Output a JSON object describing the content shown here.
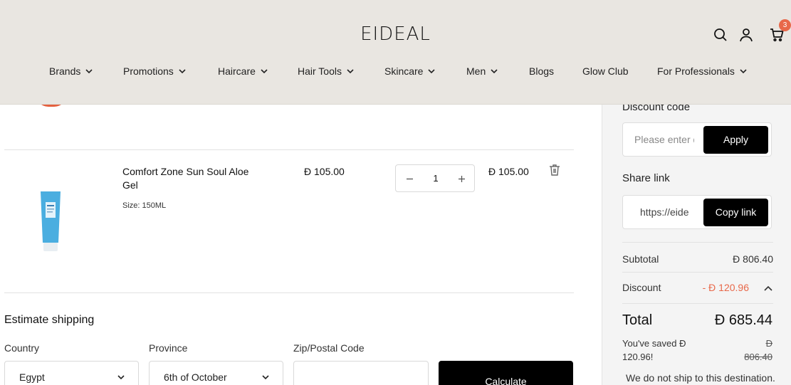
{
  "header": {
    "logo": "EIDEAL",
    "cart_count": "3",
    "icons": {
      "search": "search-icon",
      "account": "user-icon",
      "cart": "cart-icon"
    },
    "nav": [
      {
        "label": "Brands",
        "dropdown": true
      },
      {
        "label": "Promotions",
        "dropdown": true
      },
      {
        "label": "Haircare",
        "dropdown": true
      },
      {
        "label": "Hair Tools",
        "dropdown": true
      },
      {
        "label": "Skincare",
        "dropdown": true
      },
      {
        "label": "Men",
        "dropdown": true
      },
      {
        "label": "Blogs",
        "dropdown": false
      },
      {
        "label": "Glow Club",
        "dropdown": false
      },
      {
        "label": "For Professionals",
        "dropdown": true
      }
    ]
  },
  "cart": {
    "item": {
      "name": "Comfort Zone Sun Soul Aloe Gel",
      "size": "Size: 150ML",
      "price": "Ð 105.00",
      "quantity": "1",
      "total": "Ð 105.00"
    }
  },
  "shipping": {
    "title": "Estimate shipping",
    "country_label": "Country",
    "country_value": "Egypt",
    "province_label": "Province",
    "province_value": "6th of October",
    "zip_label": "Zip/Postal Code",
    "calculate": "Calculate"
  },
  "summary": {
    "discount_label": "Discount code",
    "discount_placeholder": "Please enter discount code",
    "apply": "Apply",
    "share_label": "Share link",
    "share_value": "https://eide",
    "copy": "Copy link",
    "subtotal_label": "Subtotal",
    "subtotal_value": "Ð 806.40",
    "discount_row_label": "Discount",
    "discount_row_value": "- Ð 120.96",
    "total_label": "Total",
    "total_value": "Ð 685.44",
    "saved_text": "You've saved Ð 120.96!",
    "old_currency": "Ð",
    "old_price": "806.40",
    "no_ship": "We do not ship to this destination."
  },
  "colors": {
    "header_bg": "#e9e6e1",
    "accent_discount": "#e8684a",
    "button": "#000000"
  }
}
